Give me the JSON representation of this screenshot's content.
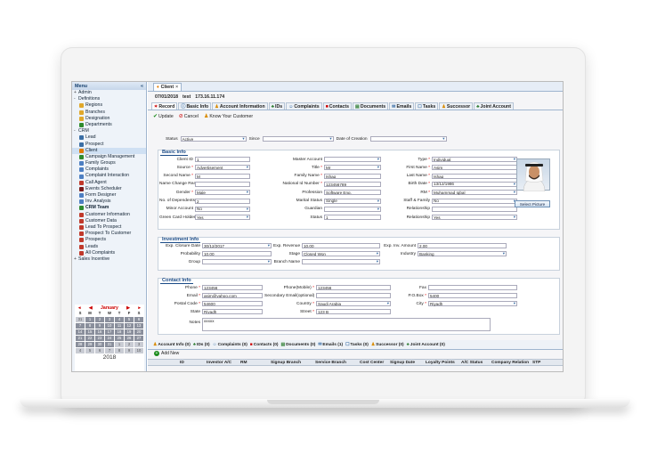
{
  "sidebar": {
    "title": "Menu",
    "items": [
      {
        "label": "Admin",
        "level": 0,
        "toggle": "+",
        "icon": "none"
      },
      {
        "label": "Definitions",
        "level": 0,
        "toggle": "-",
        "icon": "none"
      },
      {
        "label": "Regions",
        "level": 1,
        "icon": "folder"
      },
      {
        "label": "Branches",
        "level": 1,
        "icon": "folder"
      },
      {
        "label": "Designation",
        "level": 1,
        "icon": "folder"
      },
      {
        "label": "Departments",
        "level": 1,
        "icon": "green"
      },
      {
        "label": "CRM",
        "level": 0,
        "toggle": "-",
        "icon": "none"
      },
      {
        "label": "Lead",
        "level": 1,
        "icon": "person"
      },
      {
        "label": "Prospect",
        "level": 1,
        "icon": "person"
      },
      {
        "label": "Client",
        "level": 1,
        "icon": "orange"
      },
      {
        "label": "Campaign Management",
        "level": 1,
        "icon": "green"
      },
      {
        "label": "Family Groups",
        "level": 1,
        "icon": "blue"
      },
      {
        "label": "Complaints",
        "level": 1,
        "icon": "blue"
      },
      {
        "label": "Complaint Interaction",
        "level": 1,
        "icon": "blue"
      },
      {
        "label": "Call Agent",
        "level": 1,
        "icon": "red"
      },
      {
        "label": "Events Scheduler",
        "level": 1,
        "icon": "darkred"
      },
      {
        "label": "Form Designer",
        "level": 1,
        "icon": "blue"
      },
      {
        "label": "Inv. Analysis",
        "level": 1,
        "icon": "blue"
      },
      {
        "label": "CRM Team",
        "level": 1,
        "icon": "green",
        "bold": true
      },
      {
        "label": "Customer Information",
        "level": 1,
        "icon": "red"
      },
      {
        "label": "Customer Data",
        "level": 1,
        "icon": "red"
      },
      {
        "label": "Lead To Prospect",
        "level": 1,
        "icon": "red"
      },
      {
        "label": "Prospect To Customer",
        "level": 1,
        "icon": "red"
      },
      {
        "label": "Prospects",
        "level": 1,
        "icon": "red"
      },
      {
        "label": "Leads",
        "level": 1,
        "icon": "red"
      },
      {
        "label": "All Complaints",
        "level": 1,
        "icon": "red"
      },
      {
        "label": "Sales Incentive",
        "level": 0,
        "toggle": "+",
        "icon": "none"
      }
    ]
  },
  "calendar": {
    "month": "January",
    "year": "2018",
    "prev": "◀",
    "next": "▶",
    "prev2": "◂",
    "next2": "▸",
    "days": [
      "S",
      "M",
      "T",
      "W",
      "T",
      "F",
      "S"
    ],
    "cells": [
      "31",
      "1",
      "2",
      "3",
      "4",
      "5",
      "6",
      "7",
      "8",
      "9",
      "10",
      "11",
      "12",
      "13",
      "14",
      "15",
      "16",
      "17",
      "18",
      "19",
      "20",
      "21",
      "22",
      "23",
      "24",
      "25",
      "26",
      "27",
      "28",
      "29",
      "30",
      "31",
      "1",
      "2",
      "3",
      "4",
      "5",
      "6",
      "7",
      "8",
      "9",
      "10"
    ]
  },
  "tab": {
    "label": "Client",
    "close": "×"
  },
  "info": {
    "date": "07/01/2018",
    "user": "test",
    "ip": "173.16.11.174"
  },
  "subtabs": [
    "Record",
    "Basic Info",
    "Account Information",
    "IDs",
    "Complaints",
    "Contacts",
    "Documents",
    "Emails",
    "Tasks",
    "Successor",
    "Joint Account"
  ],
  "actions": {
    "update": "Update",
    "cancel": "Cancel",
    "know": "Know Your Customer"
  },
  "status": {
    "label": "Status",
    "value": "Active",
    "since": "Since",
    "doc_label": "Date of Creation"
  },
  "basic": {
    "title": "Basic Info",
    "left": [
      [
        "Client ID",
        false,
        "1",
        "input"
      ],
      [
        "Source",
        true,
        "Advertisement",
        "select"
      ],
      [
        "Second Name",
        true,
        "M",
        "input"
      ],
      [
        "Name Change Reason",
        "",
        "",
        "input"
      ],
      [
        "Gender",
        true,
        "Male",
        "select"
      ],
      [
        "No. of Dependents",
        true,
        "2",
        "input"
      ],
      [
        "Minor Account",
        "",
        "No",
        "select"
      ],
      [
        "Green Card Holder",
        "",
        "Yes",
        "select"
      ]
    ],
    "mid": [
      [
        "Master Account",
        "",
        "",
        "select"
      ],
      [
        "Title",
        true,
        "Mr",
        "select"
      ],
      [
        "Family Name",
        true,
        "Ishaq",
        "input"
      ],
      [
        "National Id Number",
        true,
        "123456789",
        "input"
      ],
      [
        "Profession",
        "",
        "Software Eng.",
        "input"
      ],
      [
        "Marital Status",
        "",
        "Single",
        "select"
      ],
      [
        "Guardian",
        "",
        "",
        "select"
      ],
      [
        "Status",
        "",
        "1",
        "input"
      ]
    ],
    "right": [
      [
        "Type",
        true,
        "Individual",
        "select"
      ],
      [
        "First Name",
        true,
        "Asim",
        "input"
      ],
      [
        "Last Name",
        true,
        "Ishaq",
        "input"
      ],
      [
        "Birth Date",
        true,
        "13/12/1986",
        "select"
      ],
      [
        "RM",
        true,
        "Muhammad Iqbal",
        "select"
      ],
      [
        "Staff & Family",
        "",
        "No",
        "select"
      ],
      [
        "Relationship",
        "",
        "",
        "input"
      ],
      [
        "Relationship",
        "",
        "Yes",
        "select"
      ]
    ],
    "select_picture": "Select Picture"
  },
  "investment": {
    "title": "Investment Info",
    "closure_label": "Exp. Closure Date",
    "closure": "30/12/2017",
    "revenue_label": "Exp. Revenue",
    "revenue": "10.00",
    "amount_label": "Exp. Inv. Amount",
    "amount": "2.00",
    "prob_label": "Probability",
    "prob": "10.00",
    "stage_label": "Stage",
    "stage": "Closed Won",
    "industry_label": "Industry",
    "industry": "Banking",
    "group_label": "Group",
    "group": "",
    "branch_label": "Branch Name",
    "branch": ""
  },
  "contact": {
    "title": "Contact Info",
    "phone_label": "Phone",
    "phone": "123456",
    "mobile_label": "Phone(Mobile)",
    "mobile": "123456",
    "fax_label": "Fax",
    "fax": "",
    "email_label": "Email",
    "email": "asim@yahoo.com",
    "semail_label": "Secondary Email(optional)",
    "semail": "",
    "pobox_label": "P.O.Box",
    "pobox": "5400",
    "postal_label": "Postal Code",
    "postal": "54600",
    "country_label": "Country",
    "country": "Saudi Arabia",
    "city_label": "City",
    "city": "Riyadh",
    "state_label": "State",
    "state": "Riyadh",
    "street_label": "Street",
    "street": "123 B",
    "notes_label": "Notes",
    "notes": "xxxxx"
  },
  "bottom_tabs": [
    "Account Info (0)",
    "IDs (0)",
    "Complaints (0)",
    "Contacts (0)",
    "Documents (0)",
    "Emails (1)",
    "Tasks (0)",
    "Successor (0)",
    "Joint Account (0)"
  ],
  "add_new": "Add New",
  "grid_cols": [
    "ID",
    "Investor A/C",
    "RM",
    "Signup Branch",
    "Service Branch",
    "Cost Center",
    "Signup Date",
    "Loyalty Points",
    "A/C Status",
    "Company Relation",
    "STP"
  ],
  "colors": {
    "accent": "#1a4a86",
    "required": "#dd0000",
    "active_tab": "#ffffff"
  }
}
